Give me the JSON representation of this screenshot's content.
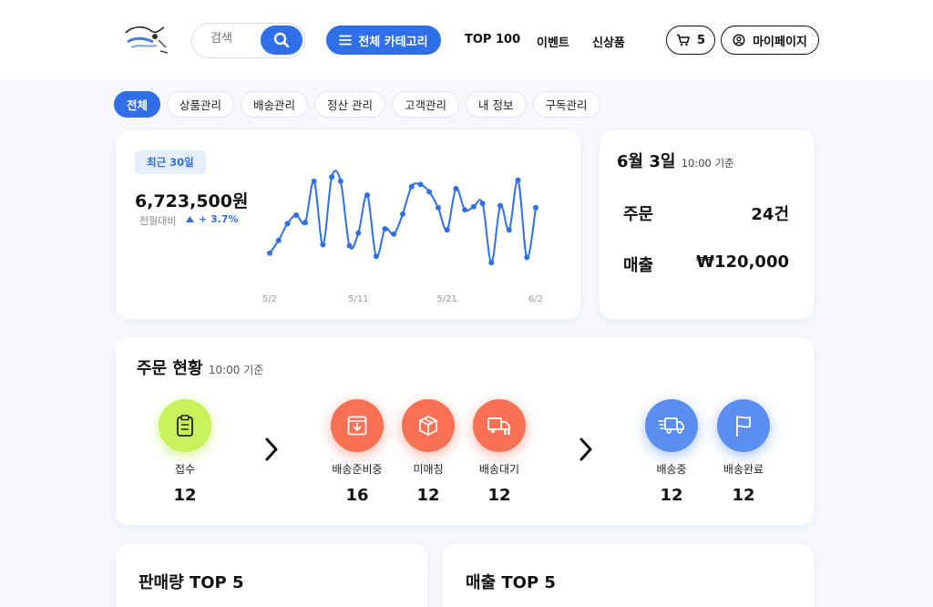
{
  "header": {
    "search": {
      "placeholder": "검색"
    },
    "category_button": "전체 카테고리",
    "nav": [
      "TOP 100",
      "이벤트",
      "신상품"
    ],
    "cart_count": "5",
    "mypage": "마이페이지",
    "icons": [
      "logo",
      "search-icon",
      "menu-icon",
      "cart-icon",
      "user-icon"
    ]
  },
  "tabs": [
    "전체",
    "상품관리",
    "배송관리",
    "정산 관리",
    "고객관리",
    "내 정보",
    "구독관리"
  ],
  "active_tab": "전체",
  "sales": {
    "badge": "최근 30일",
    "amount": "6,723,500원",
    "compare_label": "전월대비",
    "compare_value": "+ 3.7%"
  },
  "chart_data": {
    "type": "line",
    "x_ticks": [
      "5/2",
      "5/11",
      "5/21",
      "6/2"
    ],
    "values": [
      20,
      32,
      48,
      56,
      49,
      88,
      28,
      92,
      88,
      27,
      39,
      75,
      17,
      43,
      38,
      57,
      83,
      85,
      78,
      63,
      42,
      81,
      61,
      64,
      67,
      11,
      65,
      42,
      89,
      16,
      63
    ],
    "ylim": [
      0,
      100
    ],
    "color": "#2f6fe8"
  },
  "today": {
    "date": "6월 3일",
    "time": "10:00 기준",
    "orders_label": "주문",
    "orders_value": "24건",
    "revenue_label": "매출",
    "revenue_value": "₩120,000"
  },
  "order_status": {
    "title": "주문 현황",
    "time": "10:00 기준",
    "steps": [
      {
        "label": "접수",
        "count": "12",
        "color": "#c8f25a",
        "icon": "clipboard-icon"
      },
      {
        "label": "배송준비중",
        "count": "16",
        "color": "#f97155",
        "icon": "download-box-icon"
      },
      {
        "label": "미매칭",
        "count": "12",
        "color": "#f97155",
        "icon": "package-icon"
      },
      {
        "label": "배송대기",
        "count": "12",
        "color": "#f97155",
        "icon": "truck-wait-icon"
      },
      {
        "label": "배송중",
        "count": "12",
        "color": "#5a8ef0",
        "icon": "truck-fast-icon"
      },
      {
        "label": "배송완료",
        "count": "12",
        "color": "#5a8ef0",
        "icon": "flag-icon"
      }
    ]
  },
  "bottom": {
    "left_title": "판매량 TOP 5",
    "right_title": "매출 TOP 5"
  }
}
